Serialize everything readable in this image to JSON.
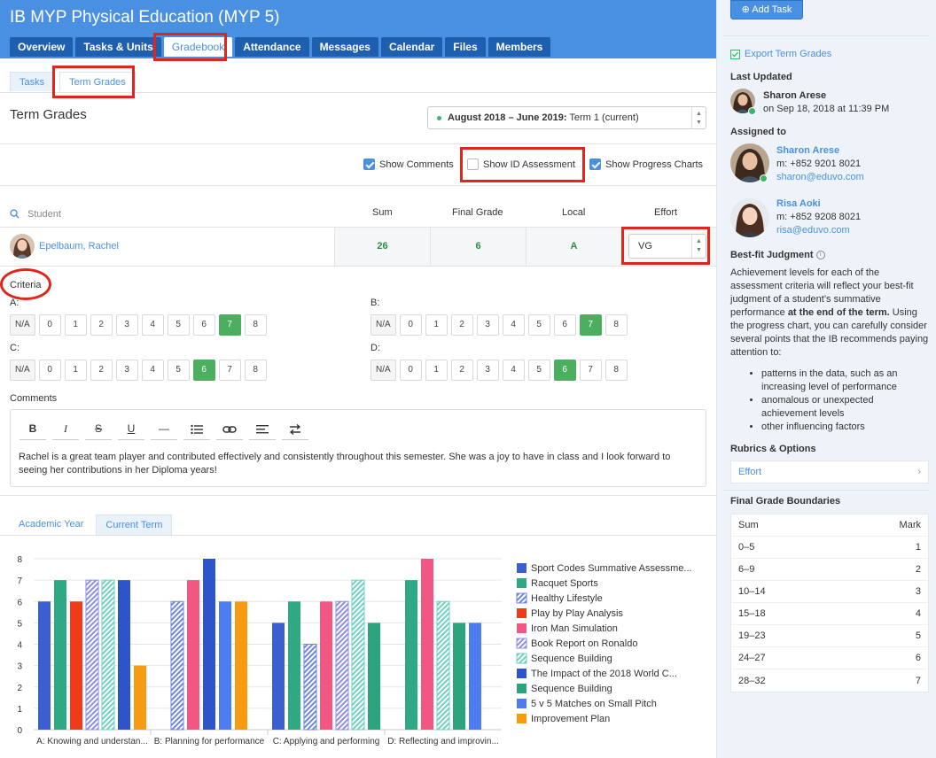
{
  "app": {
    "title": "IB MYP Physical Education (MYP 5)"
  },
  "nav_tabs": [
    "Overview",
    "Tasks & Units",
    "Gradebook",
    "Attendance",
    "Messages",
    "Calendar",
    "Files",
    "Members"
  ],
  "sub_tabs": [
    "Tasks",
    "Term Grades"
  ],
  "page_title": "Term Grades",
  "term_select": {
    "range": "August 2018 – June 2019:",
    "term": "Term 1 (current)"
  },
  "options": {
    "show_comments": {
      "label": "Show Comments",
      "checked": true
    },
    "show_id_assessment": {
      "label": "Show ID Assessment",
      "checked": false
    },
    "show_progress_charts": {
      "label": "Show Progress Charts",
      "checked": true
    }
  },
  "table": {
    "headers": {
      "student": "Student",
      "sum": "Sum",
      "final_grade": "Final Grade",
      "local": "Local",
      "effort": "Effort"
    },
    "row": {
      "name": "Epelbaum, Rachel",
      "sum": "26",
      "final_grade": "6",
      "local": "A",
      "effort": "VG"
    }
  },
  "criteria": {
    "label": "Criteria",
    "options": [
      "N/A",
      "0",
      "1",
      "2",
      "3",
      "4",
      "5",
      "6",
      "7",
      "8"
    ],
    "items": [
      {
        "letter": "A:",
        "selected": "7"
      },
      {
        "letter": "B:",
        "selected": "7"
      },
      {
        "letter": "C:",
        "selected": "6"
      },
      {
        "letter": "D:",
        "selected": "6"
      }
    ]
  },
  "comments": {
    "label": "Comments",
    "text": "Rachel is a great team player and contributed effectively and consistently throughout this semester. She was a joy to have in class and I look forward to seeing her contributions in her Diploma years!"
  },
  "chart_tabs": [
    "Academic Year",
    "Current Term"
  ],
  "chart_data": {
    "type": "bar",
    "categories": [
      "A: Knowing and understan...",
      "B: Planning for performance",
      "C: Applying and performing",
      "D: Reflecting and improvin..."
    ],
    "ylim": [
      0,
      8
    ],
    "yticks": [
      "0",
      "1",
      "2",
      "3",
      "4",
      "5",
      "6",
      "7",
      "8"
    ],
    "grid": true,
    "legend": "right",
    "series": [
      {
        "name": "Sport Codes Summative Assessme...",
        "color": "#3b5fd1",
        "pattern": "solid",
        "values": [
          6,
          null,
          5,
          null
        ]
      },
      {
        "name": "Racquet Sports",
        "color": "#2fa884",
        "pattern": "solid",
        "values": [
          7,
          null,
          6,
          7
        ]
      },
      {
        "name": "Healthy Lifestyle",
        "color": "#6f86e0",
        "pattern": "hatch",
        "values": [
          null,
          6,
          4,
          null
        ]
      },
      {
        "name": "Play by Play Analysis",
        "color": "#f03a1a",
        "pattern": "solid",
        "values": [
          6,
          null,
          null,
          null
        ]
      },
      {
        "name": "Iron Man Simulation",
        "color": "#f25783",
        "pattern": "solid",
        "values": [
          null,
          7,
          6,
          8
        ]
      },
      {
        "name": "Book Report on Ronaldo",
        "color": "#8e8ee6",
        "pattern": "hatch",
        "values": [
          7,
          null,
          6,
          null
        ]
      },
      {
        "name": "Sequence Building",
        "color": "#70d1c2",
        "pattern": "hatch",
        "values": [
          7,
          null,
          7,
          6
        ]
      },
      {
        "name": "The Impact of the 2018 World C...",
        "color": "#2d55c9",
        "pattern": "solid",
        "values": [
          7,
          8,
          null,
          null
        ]
      },
      {
        "name": "Sequence Building",
        "color": "#2aa37e",
        "pattern": "solid",
        "values": [
          null,
          null,
          5,
          5
        ]
      },
      {
        "name": "5 v 5 Matches on Small Pitch",
        "color": "#4d7cf0",
        "pattern": "solid",
        "values": [
          null,
          6,
          null,
          5
        ]
      },
      {
        "name": "Improvement Plan",
        "color": "#f79b10",
        "pattern": "solid",
        "values": [
          3,
          6,
          null,
          null
        ]
      }
    ]
  },
  "sidebar": {
    "add_task": "Add Task",
    "export": "Export Term Grades",
    "last_updated": {
      "heading": "Last Updated",
      "name": "Sharon Arese",
      "when": "on Sep 18, 2018 at 11:39 PM"
    },
    "assigned_heading": "Assigned to",
    "assignees": [
      {
        "name": "Sharon Arese",
        "phone": "m: +852 9201 8021",
        "email": "sharon@eduvo.com"
      },
      {
        "name": "Risa Aoki",
        "phone": "m: +852 9208 8021",
        "email": "risa@eduvo.com"
      }
    ],
    "best_fit": {
      "heading": "Best-fit Judgment",
      "text_before": "Achievement levels for each of the assessment criteria will reflect your best-fit judgment of a student’s summative performance ",
      "text_bold": "at the end of the term.",
      "text_after": " Using the progress chart, you can carefully consider several points that the IB recommends paying attention to:",
      "bullets": [
        "patterns in the data, such as an increasing level of performance",
        "anomalous or unexpected achievement levels",
        "other influencing factors"
      ]
    },
    "rubrics": {
      "heading": "Rubrics & Options",
      "effort": "Effort"
    },
    "boundaries": {
      "heading": "Final Grade Boundaries",
      "col_sum": "Sum",
      "col_mark": "Mark",
      "rows": [
        {
          "sum": "0–5",
          "mark": "1"
        },
        {
          "sum": "6–9",
          "mark": "2"
        },
        {
          "sum": "10–14",
          "mark": "3"
        },
        {
          "sum": "15–18",
          "mark": "4"
        },
        {
          "sum": "19–23",
          "mark": "5"
        },
        {
          "sum": "24–27",
          "mark": "6"
        },
        {
          "sum": "28–32",
          "mark": "7"
        }
      ]
    }
  }
}
